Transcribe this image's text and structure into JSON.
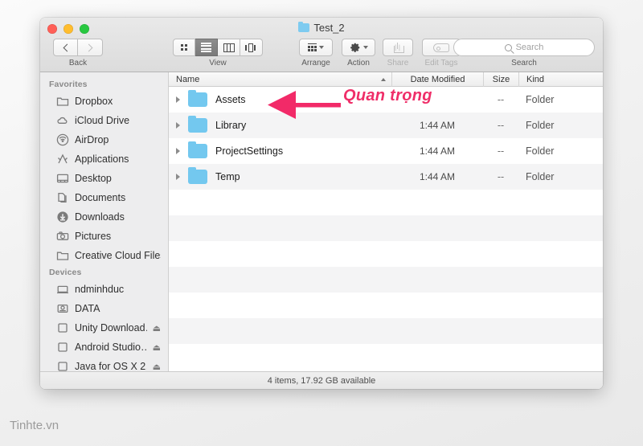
{
  "window": {
    "title": "Test_2",
    "title_icon": "folder-icon",
    "traffic_lights": [
      {
        "name": "close",
        "color": "#ff5f57"
      },
      {
        "name": "minimize",
        "color": "#ffbd2e"
      },
      {
        "name": "maximize",
        "color": "#28c840"
      }
    ]
  },
  "toolbar": {
    "back_label": "Back",
    "back_icon": "chevron-left-icon",
    "forward_icon": "chevron-right-icon",
    "view_label": "View",
    "view_options": [
      "icon-view",
      "list-view",
      "column-view",
      "coverflow-view"
    ],
    "view_selected": "list-view",
    "arrange_label": "Arrange",
    "arrange_icon": "arrange-icon",
    "action_label": "Action",
    "action_icon": "gear-icon",
    "share_label": "Share",
    "share_icon": "share-icon",
    "share_enabled": false,
    "edit_tags_label": "Edit Tags",
    "edit_tags_icon": "tag-icon",
    "edit_tags_enabled": false,
    "search_label": "Search",
    "search_placeholder": "Search",
    "search_value": "",
    "search_icon": "search-icon"
  },
  "sidebar": {
    "sections": [
      {
        "header": "Favorites",
        "items": [
          {
            "label": "Dropbox",
            "icon": "folder-outline-icon",
            "eject": false
          },
          {
            "label": "iCloud Drive",
            "icon": "cloud-icon",
            "eject": false
          },
          {
            "label": "AirDrop",
            "icon": "airdrop-icon",
            "eject": false
          },
          {
            "label": "Applications",
            "icon": "applications-icon",
            "eject": false
          },
          {
            "label": "Desktop",
            "icon": "desktop-icon",
            "eject": false
          },
          {
            "label": "Documents",
            "icon": "documents-icon",
            "eject": false
          },
          {
            "label": "Downloads",
            "icon": "downloads-icon",
            "eject": false
          },
          {
            "label": "Pictures",
            "icon": "camera-icon",
            "eject": false
          },
          {
            "label": "Creative Cloud Files",
            "icon": "folder-outline-icon",
            "eject": false
          }
        ]
      },
      {
        "header": "Devices",
        "items": [
          {
            "label": "ndminhduc",
            "icon": "laptop-icon",
            "eject": false
          },
          {
            "label": "DATA",
            "icon": "harddisk-icon",
            "eject": false
          },
          {
            "label": "Unity Download…",
            "icon": "disk-icon",
            "eject": true
          },
          {
            "label": "Android Studio…",
            "icon": "disk-icon",
            "eject": true
          },
          {
            "label": "Java for OS X 2…",
            "icon": "disk-icon",
            "eject": true
          }
        ]
      }
    ],
    "eject_icon": "eject-icon"
  },
  "file_list": {
    "columns": [
      "Name",
      "Date Modified",
      "Size",
      "Kind"
    ],
    "sort_column": "Name",
    "sort_direction": "ascending",
    "sort_icon": "caret-up-icon",
    "disclosure_icon": "disclosure-triangle-icon",
    "row_icon": "folder-icon",
    "rows": [
      {
        "name": "Assets",
        "date": "",
        "size": "--",
        "kind": "Folder"
      },
      {
        "name": "Library",
        "date": "1:44 AM",
        "size": "--",
        "kind": "Folder"
      },
      {
        "name": "ProjectSettings",
        "date": "1:44 AM",
        "size": "--",
        "kind": "Folder"
      },
      {
        "name": "Temp",
        "date": "1:44 AM",
        "size": "--",
        "kind": "Folder"
      }
    ],
    "empty_rows": 7
  },
  "statusbar": {
    "text": "4 items, 17.92 GB available"
  },
  "annotation": {
    "text": "Quan trọng",
    "arrow_icon": "arrow-left-icon",
    "color": "#ef2e68",
    "outline_color": "#ffffff"
  },
  "watermark": {
    "text": "Tinhte.vn"
  }
}
